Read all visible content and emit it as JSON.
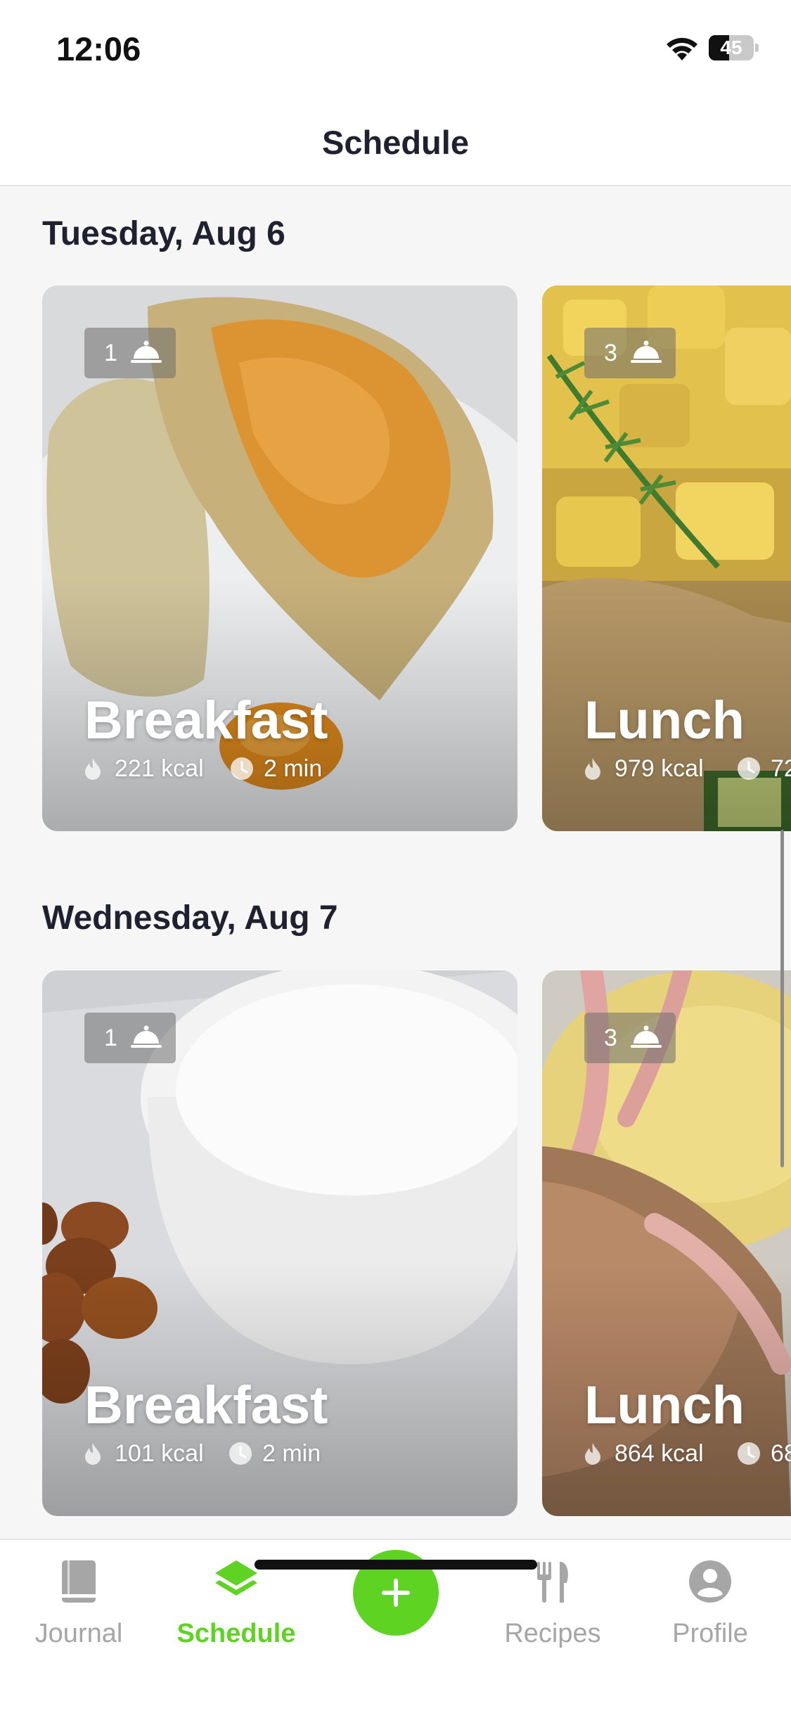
{
  "status_bar": {
    "time": "12:06",
    "battery_level": "45",
    "battery_fraction": 0.45
  },
  "header": {
    "title": "Schedule"
  },
  "days": [
    {
      "heading": "Tuesday, Aug 6",
      "meals": [
        {
          "name": "Breakfast",
          "servings": "1",
          "kcal": "221 kcal",
          "time": "2 min"
        },
        {
          "name": "Lunch",
          "servings": "3",
          "kcal": "979 kcal",
          "time": "72"
        }
      ]
    },
    {
      "heading": "Wednesday, Aug 7",
      "meals": [
        {
          "name": "Breakfast",
          "servings": "1",
          "kcal": "101 kcal",
          "time": "2 min"
        },
        {
          "name": "Lunch",
          "servings": "3",
          "kcal": "864 kcal",
          "time": "68"
        }
      ]
    }
  ],
  "tab_bar": {
    "journal": "Journal",
    "schedule": "Schedule",
    "recipes": "Recipes",
    "profile": "Profile",
    "active": "Schedule"
  },
  "colors": {
    "accent": "#5fd321",
    "text": "#1f2130",
    "inactive": "#a6a6a6"
  },
  "icons": [
    "wifi-icon",
    "battery-icon",
    "cloche-icon",
    "flame-icon",
    "clock-icon",
    "book-icon",
    "layers-icon",
    "plus-icon",
    "fork-knife-icon",
    "user-icon"
  ]
}
